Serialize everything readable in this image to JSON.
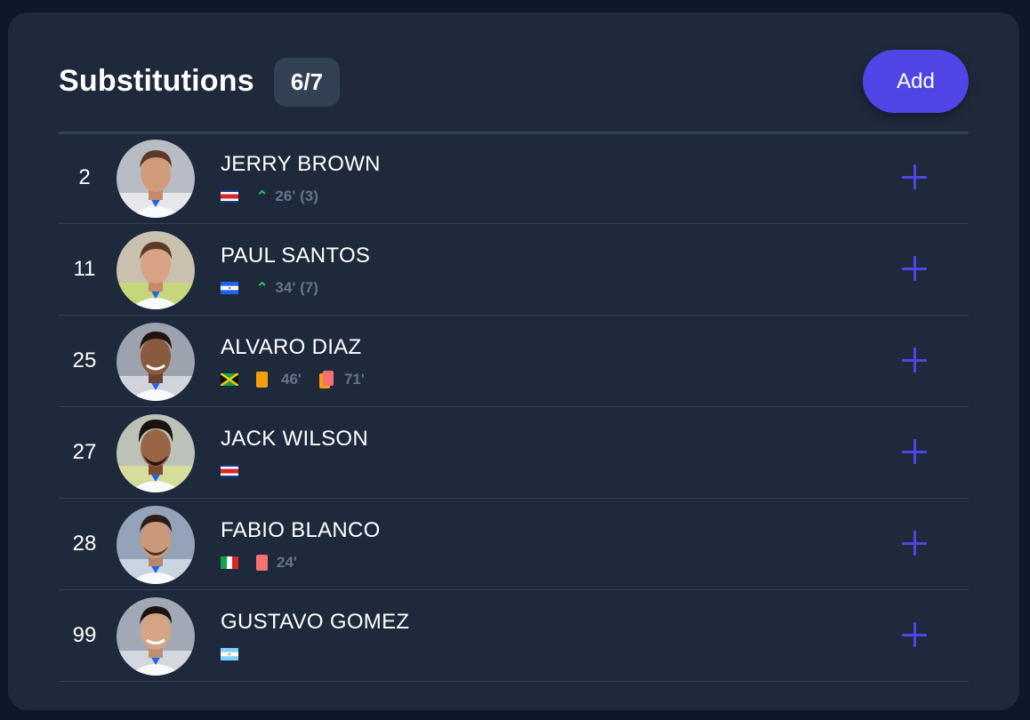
{
  "header": {
    "title": "Substitutions",
    "count": "6/7",
    "add_label": "Add"
  },
  "colors": {
    "accent": "#4f46e5",
    "yellow_card": "#f59e0b",
    "red_card": "#f87171",
    "sub_arrow": "#22c55e"
  },
  "players": [
    {
      "number": "2",
      "name": "JERRY BROWN",
      "flag": "costa-rica",
      "sub_time": "26' (3)"
    },
    {
      "number": "11",
      "name": "PAUL SANTOS",
      "flag": "nicaragua",
      "sub_time": "34' (7)"
    },
    {
      "number": "25",
      "name": "ALVARO DIAZ",
      "flag": "jamaica",
      "yellow_time": "46'",
      "second_yellow_time": "71'"
    },
    {
      "number": "27",
      "name": "JACK WILSON",
      "flag": "costa-rica"
    },
    {
      "number": "28",
      "name": "FABIO BLANCO",
      "flag": "italy",
      "red_time": "24'"
    },
    {
      "number": "99",
      "name": "GUSTAVO GOMEZ",
      "flag": "argentina"
    }
  ]
}
